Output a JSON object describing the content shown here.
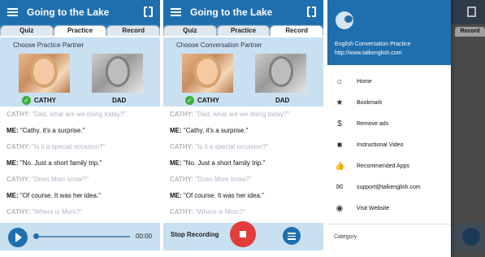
{
  "app_title": "Going to the Lake",
  "tabs": [
    "Quiz",
    "Practice",
    "Record"
  ],
  "screen1": {
    "partner_label": "Choose Practice Partner",
    "partners": [
      "CATHY",
      "DAD"
    ],
    "time": "00:00"
  },
  "screen2": {
    "partner_label": "Choose Conversation Partner",
    "partners": [
      "CATHY",
      "DAD"
    ],
    "stop_label": "Stop Recording"
  },
  "dialogue": [
    {
      "speaker": "CATHY:",
      "text": "\"Dad, what are we doing today?\"",
      "me": false
    },
    {
      "speaker": "ME:",
      "text": "\"Cathy, it's a surprise.\"",
      "me": true
    },
    {
      "speaker": "CATHY:",
      "text": "\"Is it a special occasion?\"",
      "me": false
    },
    {
      "speaker": "ME:",
      "text": "\"No.  Just a short family trip.\"",
      "me": true
    },
    {
      "speaker": "CATHY:",
      "text": "\"Does Mom know?\"",
      "me": false
    },
    {
      "speaker": "ME:",
      "text": "\"Of course.  It was her idea.\"",
      "me": true
    },
    {
      "speaker": "CATHY:",
      "text": "\"Where is Mom?\"",
      "me": false
    }
  ],
  "drawer": {
    "app_name": "English Conversation Practice",
    "url": "http://www.talkenglish.com",
    "items": [
      {
        "label": "Home",
        "icon": "home-icon",
        "glyph": "⌂"
      },
      {
        "label": "Bookmark",
        "icon": "bookmark-icon",
        "glyph": "★"
      },
      {
        "label": "Remove ads",
        "icon": "dollar-icon",
        "glyph": "$"
      },
      {
        "label": "Instructional Video",
        "icon": "video-icon",
        "glyph": "■"
      },
      {
        "label": "Recommended Apps",
        "icon": "thumbs-up-icon",
        "glyph": "👍"
      },
      {
        "label": "support@talkenglish.com",
        "icon": "email-icon",
        "glyph": "✉"
      },
      {
        "label": "Visit Website",
        "icon": "globe-icon",
        "glyph": "◉"
      }
    ],
    "category": "Category",
    "bg_tab": "Record"
  },
  "colors": {
    "primary": "#1f6fae",
    "partner_bg": "#c9e0f1",
    "record_red": "#e13d3d",
    "check_green": "#3cae3c"
  }
}
